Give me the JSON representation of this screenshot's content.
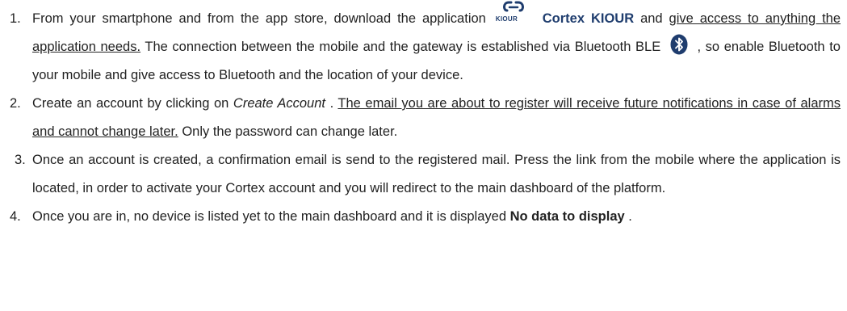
{
  "steps": [
    {
      "number": "1.",
      "t1": "From your smartphone and from the app store, download the application",
      "logo_text": "KIOUR",
      "app_name": "Cortex KIOUR",
      "t2": " and ",
      "t3_underlined": "give access to anything the application needs.",
      "t4": " The connection between the mobile and the gateway is established via Bluetooth BLE",
      "bluetooth_icon": "bluetooth-icon",
      "t5": ", so enable Bluetooth to your mobile and give access to Bluetooth and the location of your device."
    },
    {
      "number": "2.",
      "t1": "Create an account by clicking on ",
      "t2_italic": "Create Account",
      "t3": ". ",
      "t4_underlined": "The email you are about to register will receive future notifications in case of alarms and cannot change later.",
      "t5": " Only the password can change later."
    },
    {
      "number": "3.",
      "t1": "Once an account is created, a confirmation email is send to the registered mail. Press the link from the mobile where the application is located, in order to activate your Cortex account and you will redirect to the main dashboard of the platform."
    },
    {
      "number": "4.",
      "t1": "Once you are in, no device is listed yet to the main dashboard and it is displayed ",
      "t2_bold": "No data to display",
      "t3": "."
    }
  ],
  "colors": {
    "text": "#222222",
    "brand": "#1f3d6e",
    "bluetooth": "#1f3d6e"
  }
}
